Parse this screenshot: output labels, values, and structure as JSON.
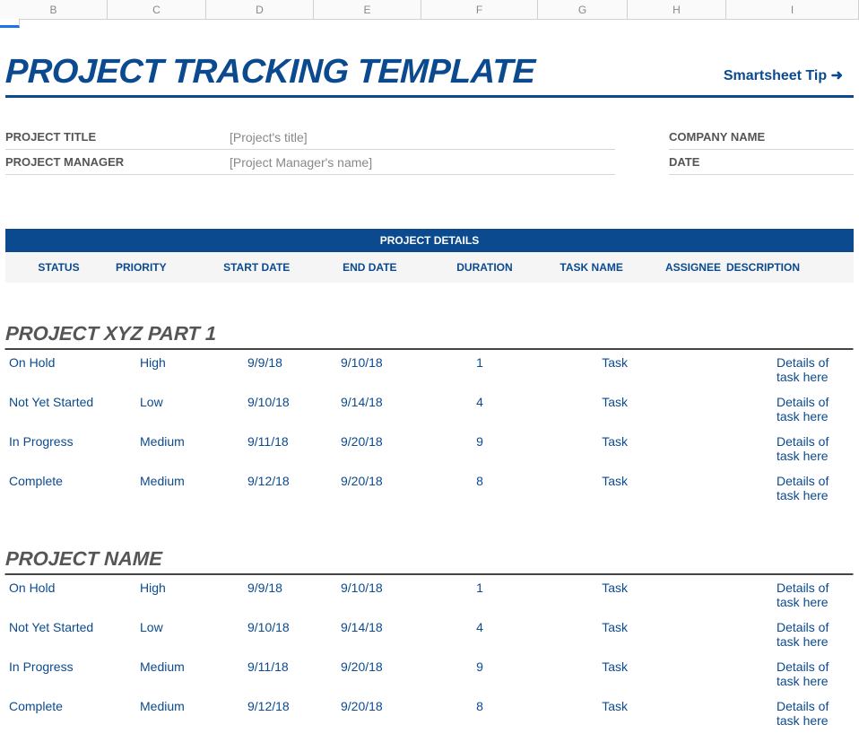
{
  "columns": {
    "b": "B",
    "c": "C",
    "d": "D",
    "e": "E",
    "f": "F",
    "g": "G",
    "h": "H",
    "i": "I"
  },
  "title": "PROJECT TRACKING TEMPLATE",
  "tip": "Smartsheet Tip ➜",
  "meta": {
    "project_title_label": "PROJECT TITLE",
    "project_title_value": "[Project's title]",
    "project_manager_label": "PROJECT MANAGER",
    "project_manager_value": "[Project Manager's name]",
    "company_name_label": "COMPANY NAME",
    "date_label": "DATE"
  },
  "details_bar": "PROJECT DETAILS",
  "headers": {
    "status": "STATUS",
    "priority": "PRIORITY",
    "start": "START DATE",
    "end": "END DATE",
    "duration": "DURATION",
    "task": "TASK NAME",
    "assignee": "ASSIGNEE",
    "desc": "DESCRIPTION"
  },
  "sections": [
    {
      "title": "PROJECT XYZ PART 1",
      "rows": [
        {
          "status": "On Hold",
          "priority": "High",
          "start": "9/9/18",
          "end": "9/10/18",
          "duration": "1",
          "task": "Task",
          "assignee": "",
          "desc": "Details of task here"
        },
        {
          "status": "Not Yet Started",
          "priority": "Low",
          "start": "9/10/18",
          "end": "9/14/18",
          "duration": "4",
          "task": "Task",
          "assignee": "",
          "desc": "Details of task here"
        },
        {
          "status": "In Progress",
          "priority": "Medium",
          "start": "9/11/18",
          "end": "9/20/18",
          "duration": "9",
          "task": "Task",
          "assignee": "",
          "desc": "Details of task here"
        },
        {
          "status": "Complete",
          "priority": "Medium",
          "start": "9/12/18",
          "end": "9/20/18",
          "duration": "8",
          "task": "Task",
          "assignee": "",
          "desc": "Details of task here"
        }
      ]
    },
    {
      "title": "PROJECT NAME",
      "rows": [
        {
          "status": "On Hold",
          "priority": "High",
          "start": "9/9/18",
          "end": "9/10/18",
          "duration": "1",
          "task": "Task",
          "assignee": "",
          "desc": "Details of task here"
        },
        {
          "status": "Not Yet Started",
          "priority": "Low",
          "start": "9/10/18",
          "end": "9/14/18",
          "duration": "4",
          "task": "Task",
          "assignee": "",
          "desc": "Details of task here"
        },
        {
          "status": "In Progress",
          "priority": "Medium",
          "start": "9/11/18",
          "end": "9/20/18",
          "duration": "9",
          "task": "Task",
          "assignee": "",
          "desc": "Details of task here"
        },
        {
          "status": "Complete",
          "priority": "Medium",
          "start": "9/12/18",
          "end": "9/20/18",
          "duration": "8",
          "task": "Task",
          "assignee": "",
          "desc": "Details of task here"
        }
      ]
    }
  ]
}
